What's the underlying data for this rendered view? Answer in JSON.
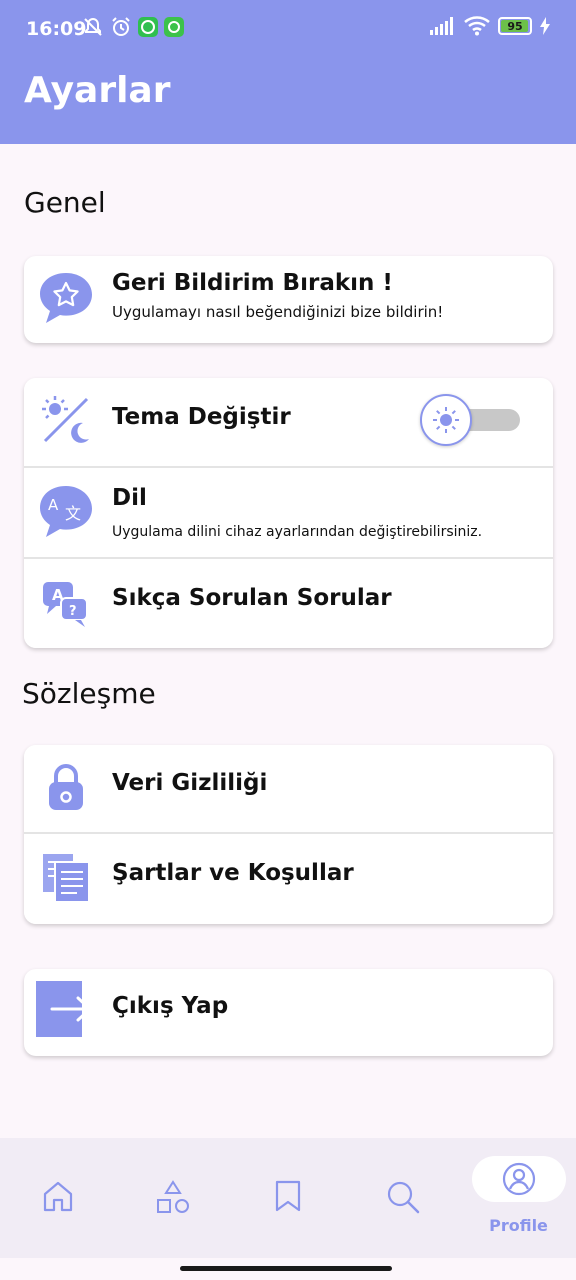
{
  "status_bar": {
    "time": "16:09",
    "battery": "95"
  },
  "header": {
    "title": "Ayarlar"
  },
  "sections": {
    "general": "Genel",
    "agreement": "Sözleşme"
  },
  "feedback": {
    "title": "Geri Bildirim Bırakın !",
    "subtitle": "Uygulamayı nasıl beğendiğinizi bize bildirin!"
  },
  "theme": {
    "title": "Tema Değiştir",
    "dark_mode_enabled": false
  },
  "language": {
    "title": "Dil",
    "subtitle": "Uygulama dilini cihaz ayarlarından değiştirebilirsiniz."
  },
  "faq": {
    "title": "Sıkça Sorulan Sorular"
  },
  "privacy": {
    "title": "Veri Gizliliği"
  },
  "terms": {
    "title": "Şartlar ve Koşullar"
  },
  "logout": {
    "title": "Çıkış Yap"
  },
  "bottom_nav": {
    "items": [
      {
        "icon": "home-icon"
      },
      {
        "icon": "shapes-icon"
      },
      {
        "icon": "bookmark-icon"
      },
      {
        "icon": "search-icon"
      },
      {
        "icon": "profile-icon",
        "label": "Profile",
        "selected": true
      }
    ]
  },
  "colors": {
    "accent": "#8a95ec",
    "background": "#fcf6fb",
    "nav_background": "#f1ecf5"
  }
}
